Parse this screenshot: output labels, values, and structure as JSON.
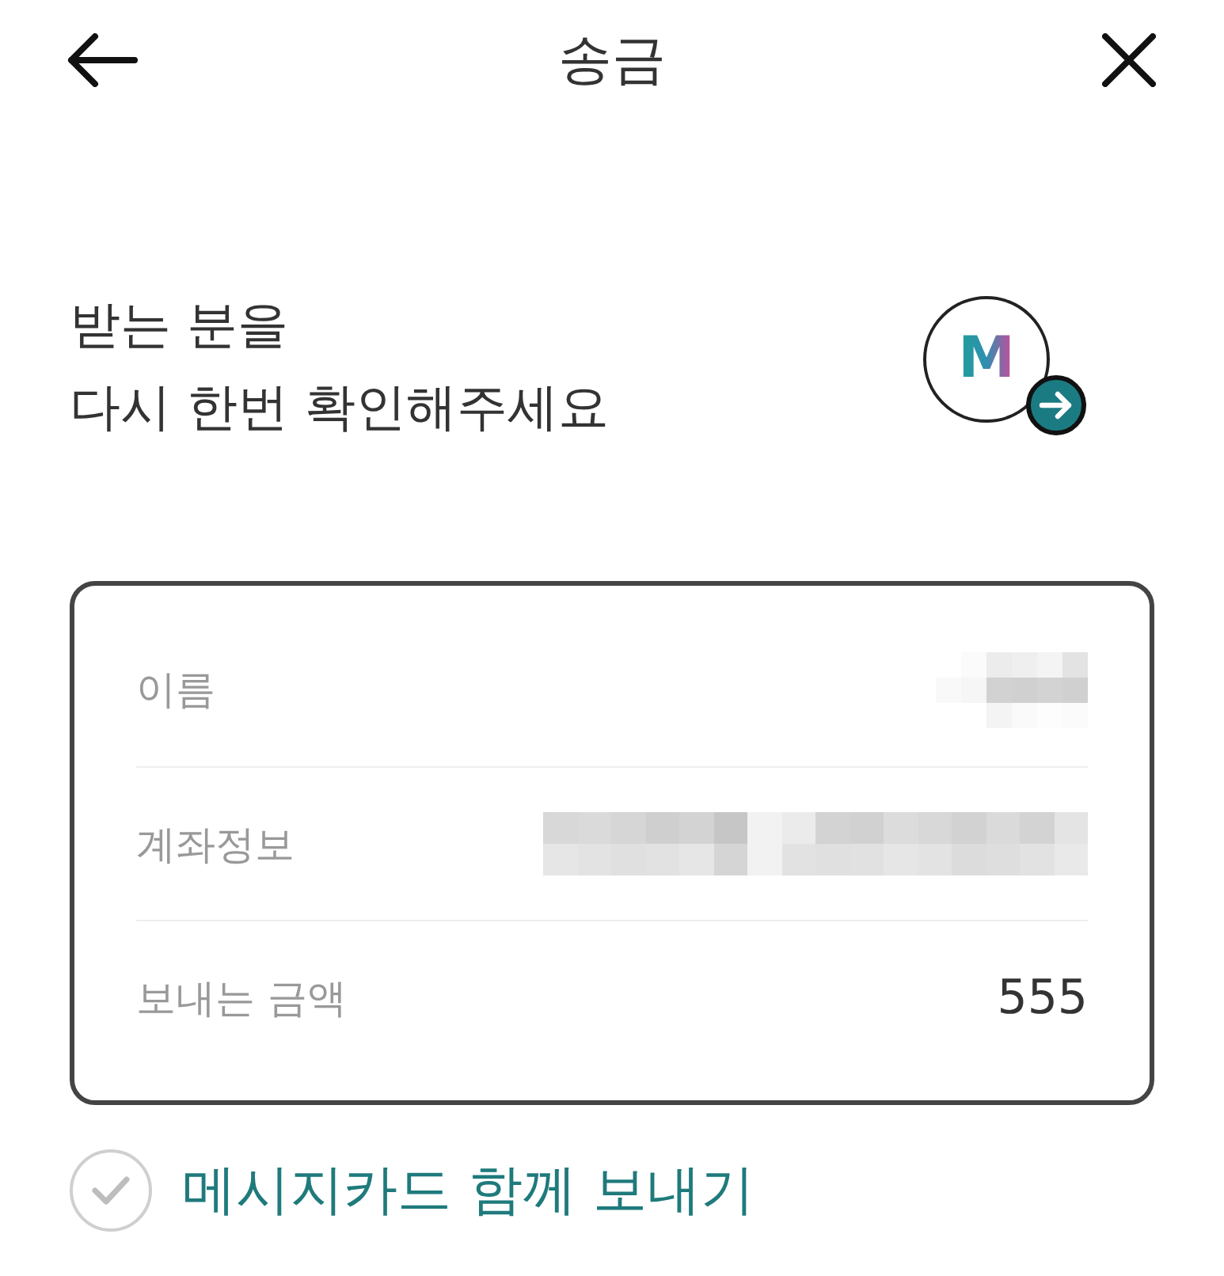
{
  "header": {
    "title": "송금"
  },
  "heading": "받는 분을\n다시 한번 확인해주세요",
  "logo": {
    "letter": "M"
  },
  "details": [
    {
      "label": "이름",
      "kind": "blurred"
    },
    {
      "label": "계좌정보",
      "kind": "blurred"
    },
    {
      "label": "보내는 금액",
      "kind": "text",
      "value": "555"
    }
  ],
  "message_card": {
    "label": "메시지카드 함께 보내기",
    "checked": false
  }
}
